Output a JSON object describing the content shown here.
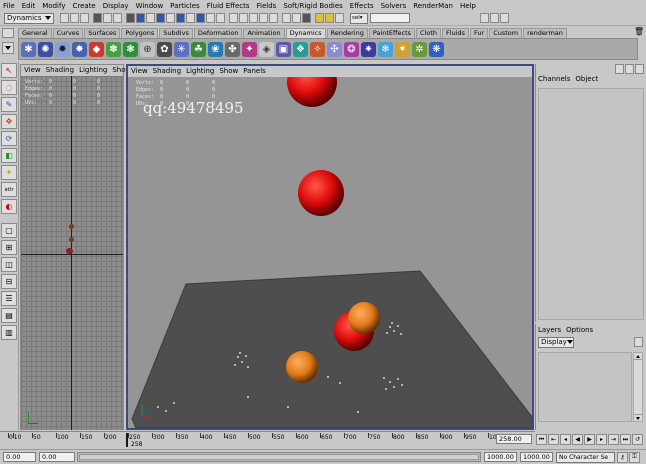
{
  "menubar": [
    "File",
    "Edit",
    "Modify",
    "Create",
    "Display",
    "Window",
    "Particles",
    "Fluid Effects",
    "Fields",
    "Soft/Rigid Bodies",
    "Effects",
    "Solvers",
    "RenderMan",
    "Help"
  ],
  "statusline": {
    "menu_set": "Dynamics",
    "sel_label": "sel▾"
  },
  "shelf": {
    "tabs": [
      "General",
      "Curves",
      "Surfaces",
      "Polygons",
      "Subdivs",
      "Deformation",
      "Animation",
      "Dynamics",
      "Rendering",
      "PaintEffects",
      "Cloth",
      "Fluids",
      "Fur",
      "Custom",
      "renderman"
    ],
    "active_tab": "Dynamics"
  },
  "left_panel": {
    "menus": [
      "View",
      "Shading",
      "Lighting",
      "Show"
    ]
  },
  "main_panel": {
    "menus": [
      "View",
      "Shading",
      "Lighting",
      "Show",
      "Panels"
    ],
    "hud": [
      {
        "label": "Verts:",
        "values": [
          "0",
          "0",
          "0"
        ]
      },
      {
        "label": "Edges:",
        "values": [
          "0",
          "0",
          "0"
        ]
      },
      {
        "label": "Faces:",
        "values": [
          "0",
          "0",
          "0"
        ]
      },
      {
        "label": "UVs:",
        "values": [
          "0",
          "0",
          "0"
        ]
      }
    ],
    "watermark": "qq:49478495"
  },
  "channel_box": {
    "menus": [
      "Channels",
      "Object"
    ]
  },
  "layer_box": {
    "menus": [
      "Layers",
      "Options"
    ],
    "display_select": "Display"
  },
  "time_slider": {
    "ticks": [
      "0",
      "10",
      "50",
      "100",
      "150",
      "200",
      "250",
      "300",
      "350",
      "400",
      "450",
      "500",
      "550",
      "600",
      "650",
      "700",
      "750",
      "800",
      "850",
      "900",
      "950",
      "1000"
    ],
    "current_frame_label": "258",
    "current_frame_field": "258.00"
  },
  "range_slider": {
    "start_time": "0.00",
    "playback_start": "0.00",
    "playback_end": "1000.00",
    "end_time": "1000.00",
    "character_set": "No Character Se"
  },
  "toolbox": {
    "attr_label": "attr"
  },
  "colors": {
    "accent": "#3e4a7e",
    "ball_red": "#e01010",
    "ball_orange": "#e08020",
    "floor": "#4e4e4e"
  }
}
